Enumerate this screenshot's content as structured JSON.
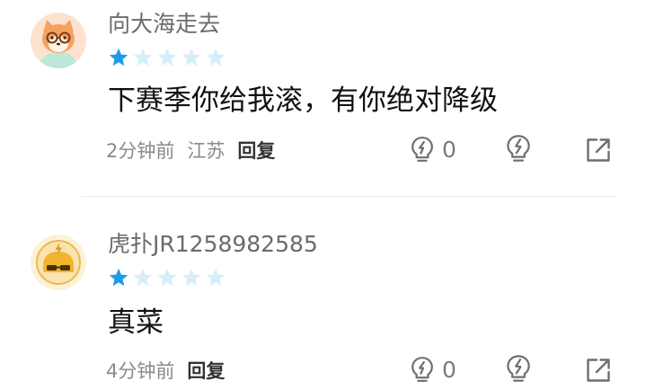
{
  "comments": [
    {
      "username": "向大海走去",
      "rating": 1,
      "rating_max": 5,
      "text": "下赛季你给我滚，有你绝对降级",
      "time": "2分钟前",
      "location": "江苏",
      "reply_label": "回复",
      "like_count": "0",
      "avatar_icon": "fox-with-glasses-avatar"
    },
    {
      "username": "虎扑JR1258982585",
      "rating": 1,
      "rating_max": 5,
      "text": "真菜",
      "time": "4分钟前",
      "reply_label": "回复",
      "like_count": "0",
      "avatar_icon": "hupu-default-avatar"
    }
  ],
  "colors": {
    "star_active": "#1e9be6",
    "star_inactive": "#d6eefc",
    "meta_text": "#8a8a8a",
    "username": "#6b6b6b",
    "icon_stroke": "#6e6e6e"
  }
}
